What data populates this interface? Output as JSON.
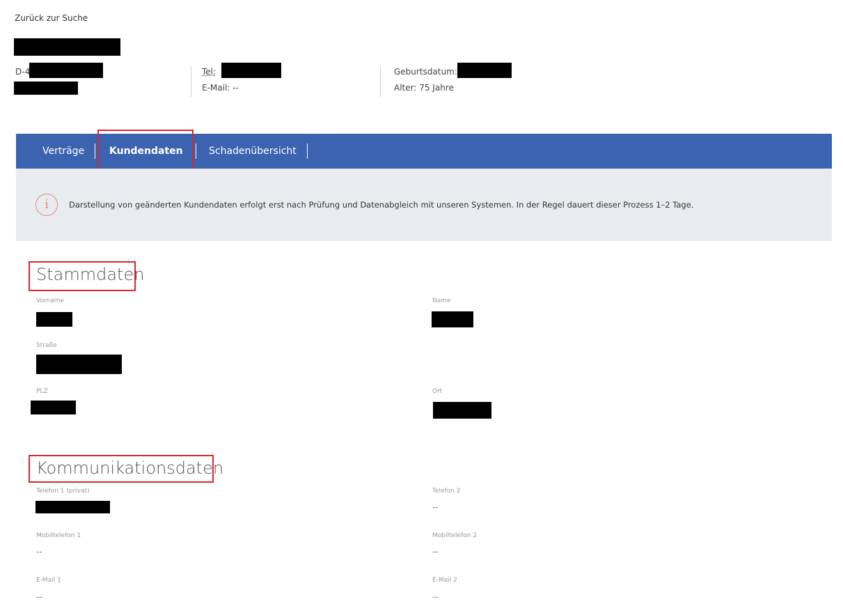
{
  "nav": {
    "back_label": "Zurück zur Suche"
  },
  "header": {
    "address_prefix": "D-4",
    "tel_label": "Tel:",
    "email_text": "E-Mail: --",
    "birthdate_label": "Geburtsdatum:",
    "age_text": "Alter: 75 Jahre"
  },
  "tabs": [
    {
      "label": "Verträge",
      "active": false
    },
    {
      "label": "Kundendaten",
      "active": true
    },
    {
      "label": "Schadenübersicht",
      "active": false
    }
  ],
  "info": {
    "icon": "info-circle-icon",
    "text": "Darstellung von geänderten Kundendaten erfolgt erst nach Prüfung und Datenabgleich mit unseren Systemen. In der Regel dauert dieser Prozess 1–2 Tage."
  },
  "stammdaten": {
    "title": "Stammdaten",
    "vorname_label": "Vorname",
    "name_label": "Name",
    "strasse_label": "Straße",
    "plz_label": "PLZ",
    "ort_label": "Ort"
  },
  "kommunikation": {
    "title": "Kommunikationsdaten",
    "telefon1_label": "Telefon 1 (privat)",
    "telefon2_label": "Telefon 2",
    "telefon2_value": "--",
    "mobil1_label": "Mobiltelefon 1",
    "mobil1_value": "--",
    "mobil2_label": "Mobiltelefon 2",
    "mobil2_value": "--",
    "email1_label": "E-Mail 1",
    "email1_value": "--",
    "email2_label": "E-Mail 2",
    "email2_value": "--"
  },
  "colors": {
    "tab_bar": "#3b63b0",
    "highlight": "#d9262c",
    "info_bg": "#e9ecef",
    "info_icon": "#e08a7a"
  }
}
